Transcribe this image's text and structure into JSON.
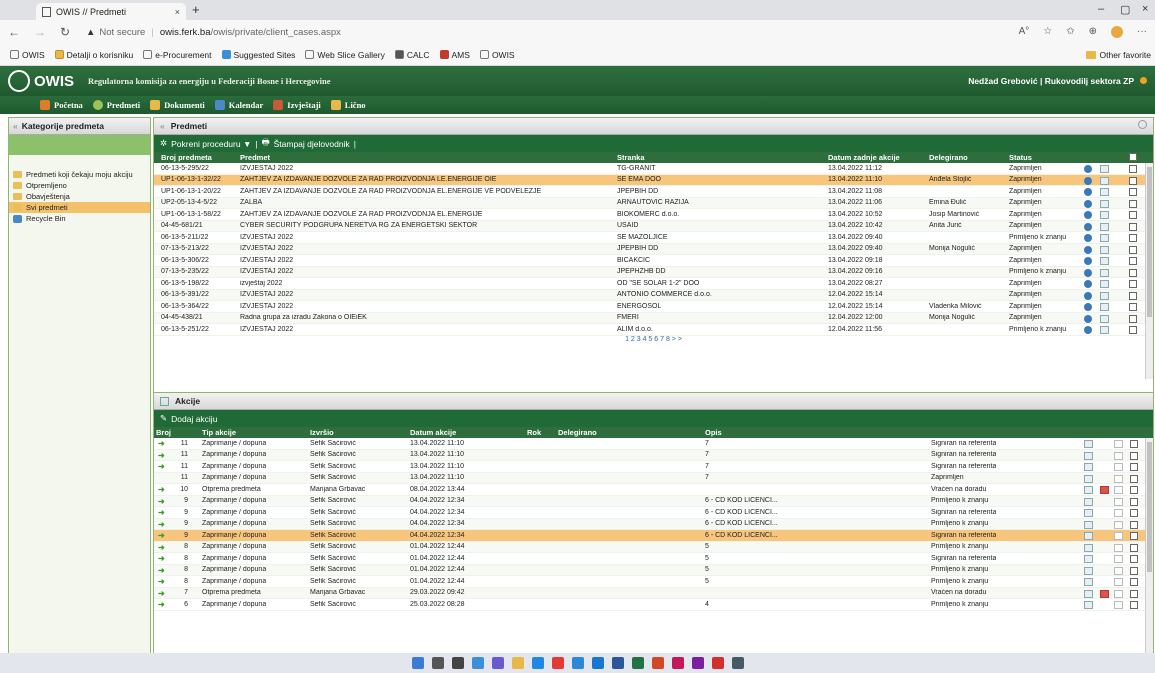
{
  "browser": {
    "tab_title": "OWIS // Predmeti",
    "url_warning": "Not secure",
    "url_host": "owis.ferk.ba",
    "url_path": "/owis/private/client_cases.aspx"
  },
  "favorites": [
    "OWIS",
    "Detalji o korisniku",
    "e-Procurement",
    "Suggested Sites",
    "Web Slice Gallery",
    "CALC",
    "AMS",
    "OWIS"
  ],
  "other_favorites": "Other favorite",
  "app": {
    "logo": "OWIS",
    "regulator": "Regulatorna komisija za energiju u Federaciji Bosne i Hercegovine",
    "user": "Nedžad Grebović | Rukovodilj sektora ZP"
  },
  "menu": [
    {
      "label": "Početna",
      "color": "#e07b2a"
    },
    {
      "label": "Predmeti",
      "color": "#9bc35a"
    },
    {
      "label": "Dokumenti",
      "color": "#e8b84a"
    },
    {
      "label": "Kalendar",
      "color": "#4a88c7"
    },
    {
      "label": "Izvještaji",
      "color": "#c85a3c"
    },
    {
      "label": "Lično",
      "color": "#e8b84a"
    }
  ],
  "left": {
    "title": "Kategorije predmeta",
    "items": [
      "Predmeti koji čekaju moju akciju",
      "Otpremljeno",
      "Obavještenja",
      "Svi predmeti",
      "Recycle Bin"
    ]
  },
  "cases": {
    "title": "Predmeti",
    "toolbar": {
      "start": "Pokreni proceduru ▼",
      "sep": "|",
      "print": "Štampaj djelovodnik",
      "sep2": "|"
    },
    "columns": [
      "Broj predmeta",
      "Predmet",
      "Stranka",
      "Datum zadnje akcije",
      "Delegirano",
      "Status"
    ],
    "rows": [
      [
        "06-13-5-295/22",
        "IZVJEŠTAJ 2022",
        "TG-GRANIT",
        "13.04.2022 11:12",
        "",
        "Zaprimljen"
      ],
      [
        "UP1-06-13-1-32/22",
        "ZAHTJEV ZA IZDAVANJE DOZVOLE ZA RAD PROIZVODNJA LE.ENERGIJE OIE",
        "SE EMA DOO",
        "13.04.2022 11:10",
        "Anđela Stojlić",
        "Zaprimljen"
      ],
      [
        "UP1-06-13-1-20/22",
        "ZAHTJEV ZA IZDAVANJE DOZVOLE ZA RAD PROIZVODNJA EL.ENERGIJE VE PODVELEŽJE",
        "JPEPBIH DD",
        "13.04.2022 11:08",
        "",
        "Zaprimljen"
      ],
      [
        "UP2-05-13-4-5/22",
        "ŽALBA",
        "ARNAUTOVIĆ RAZIJA",
        "13.04.2022 11:06",
        "Emina Đulić",
        "Zaprimljen"
      ],
      [
        "UP1-06-13-1-58/22",
        "ZAHTJEV ZA IZDAVANJE DOZVOLE ZA RAD PROIZVODNJA EL.ENERGIJE",
        "BIOKOMERC d.o.o.",
        "13.04.2022 10:52",
        "Josip Martinović",
        "Zaprimljen"
      ],
      [
        "04-45-681/21",
        "CYBER SECURITY PODGRUPA NERETVA RG ZA ENERGETSKI SEKTOR",
        "USAID",
        "13.04.2022 10:42",
        "Anita Jurić",
        "Zaprimljen"
      ],
      [
        "06-13-5-211/22",
        "IZVJEŠTAJ 2022",
        "SE MAZOLJICE",
        "13.04.2022 09:40",
        "",
        "Primljeno k znanju"
      ],
      [
        "07-13-5-213/22",
        "IZVJEŠTAJ 2022",
        "JPEPBIH DD",
        "13.04.2022 09:40",
        "Monija Nogulić",
        "Zaprimljen"
      ],
      [
        "06-13-5-306/22",
        "IZVJEŠTAJ 2022",
        "BIČAKČIĆ",
        "13.04.2022 09:18",
        "",
        "Zaprimljen"
      ],
      [
        "07-13-5-235/22",
        "IZVJEŠTAJ 2022",
        "JPEPHZHB DD",
        "13.04.2022 09:16",
        "",
        "Primljeno k znanju"
      ],
      [
        "06-13-5-198/22",
        "izvještaj 2022",
        "OD \"SE SOLAR 1-2\" DOO",
        "13.04.2022 08:27",
        "",
        "Zaprimljen"
      ],
      [
        "06-13-5-391/22",
        "IZVJEŠTAJ 2022",
        "ANTONIO COMMERCE d.o.o.",
        "12.04.2022 15:14",
        "",
        "Zaprimljen"
      ],
      [
        "06-13-5-364/22",
        "IZVJEŠTAJ 2022",
        "ENERGOSOL",
        "12.04.2022 15:14",
        "Vladenka Milović",
        "Zaprimljen"
      ],
      [
        "04-45-438/21",
        "Radna grupa za izradu Zakona o OIEiEK",
        "FMERI",
        "12.04.2022 12:00",
        "Monija Nogulić",
        "Zaprimljen"
      ],
      [
        "06-13-5-251/22",
        "IZVJEŠTAJ 2022",
        "ALIM d.o.o.",
        "12.04.2022 11:56",
        "",
        "Primljeno k znanju"
      ]
    ],
    "pager": "1 2 3 4 5 6 7 8 > >"
  },
  "actions": {
    "title": "Akcije",
    "add": "Dodaj akciju",
    "columns": [
      "Broj",
      "Tip akcije",
      "Izvršio",
      "Datum akcije",
      "Rok",
      "Delegirano",
      "Opis"
    ],
    "rows": [
      [
        "11",
        "Zaprimanje / dopuna",
        "Šefik Šaćirović",
        "13.04.2022 11:10",
        "7",
        "Signiran na referenta"
      ],
      [
        "11",
        "Zaprimanje / dopuna",
        "Šefik Šaćirović",
        "13.04.2022 11:10",
        "7",
        "Signiran na referenta"
      ],
      [
        "11",
        "Zaprimanje / dopuna",
        "Šefik Šaćirović",
        "13.04.2022 11:10",
        "7",
        "Signiran na referenta"
      ],
      [
        "11",
        "Zaprimanje / dopuna",
        "Šefik Šaćirović",
        "13.04.2022 11:10",
        "7",
        "Zaprimljen"
      ],
      [
        "10",
        "Otprema predmeta",
        "Marijana Grbavac",
        "08.04.2022 13:44",
        "",
        "Vraćen na doradu"
      ],
      [
        "9",
        "Zaprimanje / dopuna",
        "Šefik Šaćirović",
        "04.04.2022 12:34",
        "6 - CD KOD LICENCI...",
        "Primljeno k znanju"
      ],
      [
        "9",
        "Zaprimanje / dopuna",
        "Šefik Šaćirović",
        "04.04.2022 12:34",
        "6 - CD KOD LICENCI...",
        "Signiran na referenta"
      ],
      [
        "9",
        "Zaprimanje / dopuna",
        "Šefik Šaćirović",
        "04.04.2022 12:34",
        "6 - CD KOD LICENCI...",
        "Primljeno k znanju"
      ],
      [
        "9",
        "Zaprimanje / dopuna",
        "Šefik Šaćirović",
        "04.04.2022 12:34",
        "6 - CD KOD LICENCI...",
        "Signiran na referenta"
      ],
      [
        "8",
        "Zaprimanje / dopuna",
        "Šefik Šaćirović",
        "01.04.2022 12:44",
        "5",
        "Primljeno k znanju"
      ],
      [
        "8",
        "Zaprimanje / dopuna",
        "Šefik Šaćirović",
        "01.04.2022 12:44",
        "5",
        "Signiran na referenta"
      ],
      [
        "8",
        "Zaprimanje / dopuna",
        "Šefik Šaćirović",
        "01.04.2022 12:44",
        "5",
        "Primljeno k znanju"
      ],
      [
        "8",
        "Zaprimanje / dopuna",
        "Šefik Šaćirović",
        "01.04.2022 12:44",
        "5",
        "Primljeno k znanju"
      ],
      [
        "7",
        "Otprema predmeta",
        "Marijana Grbavac",
        "29.03.2022 09:42",
        "",
        "Vraćen na doradu"
      ],
      [
        "6",
        "Zaprimanje / dopuna",
        "Šefik Šaćirović",
        "25.03.2022 08:28",
        "4",
        "Primljeno k znanju"
      ]
    ]
  },
  "taskbar_icons": [
    "start-icon",
    "search-icon",
    "file-icon",
    "widgets-icon",
    "chat-icon",
    "explorer-icon",
    "edge-icon",
    "chrome-icon",
    "app1-icon",
    "app2-icon",
    "word-icon",
    "excel-icon",
    "powerpoint-icon",
    "app3-icon",
    "app4-icon",
    "app5-icon",
    "app6-icon"
  ]
}
